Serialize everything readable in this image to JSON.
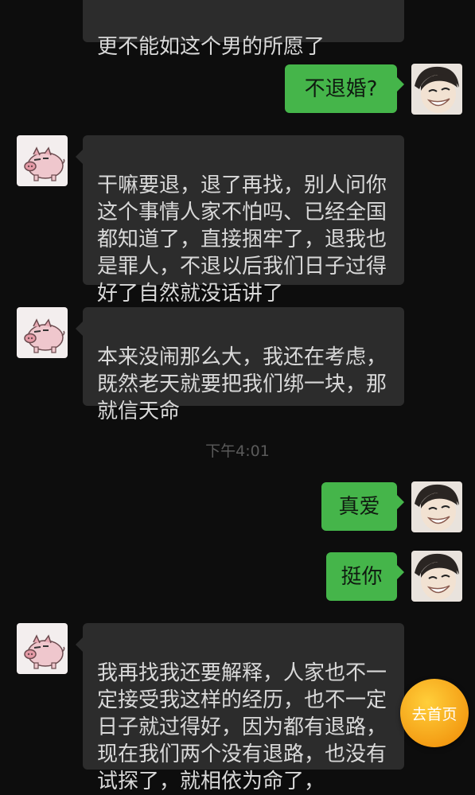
{
  "messages": [
    {
      "side": "received",
      "text": "更不能如这个男的所愿了"
    },
    {
      "side": "sent",
      "text": "不退婚?"
    },
    {
      "side": "received",
      "text": "干嘛要退，退了再找，别人问你\n这个事情人家不怕吗、已经全国\n都知道了，直接捆牢了，退我也\n是罪人，不退以后我们日子过得\n好了自然就没话讲了"
    },
    {
      "side": "received",
      "text": "本来没闹那么大，我还在考虑，\n既然老天就要把我们绑一块，那\n就信天命"
    },
    {
      "side": "sent",
      "text": "真爱"
    },
    {
      "side": "sent",
      "text": "挺你"
    },
    {
      "side": "received",
      "text": "我再找我还要解释，人家也不一\n定接受我这样的经历，也不一定\n日子就过得好，因为都有退路，\n现在我们两个没有退路，也没有\n试探了，就相依为命了，"
    }
  ],
  "timestamp": "下午4:01",
  "home_button": {
    "label": "去首页"
  },
  "colors": {
    "background": "#0d0d0d",
    "received_bubble": "#2c2c2c",
    "sent_bubble": "#45b54a",
    "home_button": "#f5a317"
  },
  "icons": {
    "received_avatar": "pig-avatar-icon",
    "sent_avatar": "smiling-person-avatar-icon"
  }
}
